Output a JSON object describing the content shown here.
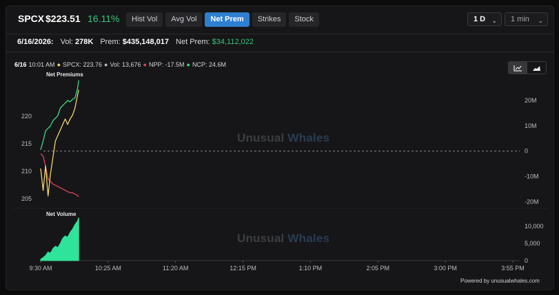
{
  "header": {
    "ticker": "SPCX",
    "price": "$223.51",
    "change_pct": "16.11%",
    "tabs": [
      {
        "label": "Hist Vol",
        "active": false
      },
      {
        "label": "Avg Vol",
        "active": false
      },
      {
        "label": "Net Prem",
        "active": true
      },
      {
        "label": "Strikes",
        "active": false
      },
      {
        "label": "Stock",
        "active": false
      }
    ],
    "range_select": "1 D",
    "interval_select": "1 min"
  },
  "stats": {
    "date": "6/16/2026:",
    "vol_label": "Vol:",
    "vol_value": "278K",
    "prem_label": "Prem:",
    "prem_value": "$435,148,017",
    "net_prem_label": "Net Prem:",
    "net_prem_value": "$34,112,022"
  },
  "legend": {
    "date": "6/16",
    "time": "10:01 AM",
    "spcx": "SPCX: 223.76",
    "vol": "Vol: 13,676",
    "npp": "NPP: -17.5M",
    "ncp": "NCP: 24.6M"
  },
  "panels": {
    "premiums_title": "Net Premiums",
    "volume_title": "Net Volume",
    "watermark_a": "Unusual",
    "watermark_b": "Whales",
    "powered_by": "Powered by unusualwhales.com"
  },
  "colors": {
    "ncp": "#3ddc84",
    "npp": "#e0455a",
    "price": "#f2d36b",
    "volume": "#2fe39a",
    "accent": "#2e7fd1"
  },
  "chart_data": {
    "type": "line",
    "x_ticks": [
      "9:30 AM",
      "10:25 AM",
      "11:20 AM",
      "12:15 PM",
      "1:10 PM",
      "2:05 PM",
      "3:00 PM",
      "3:55 PM"
    ],
    "price_axis": {
      "ticks": [
        205,
        210,
        215,
        220
      ],
      "range": [
        204,
        227
      ]
    },
    "premium_axis": {
      "ticks": [
        "20M",
        "10M",
        "0",
        "-10M",
        "-20M"
      ],
      "values": [
        20,
        10,
        0,
        -10,
        -20
      ],
      "range": [
        -21,
        29
      ]
    },
    "volume_axis": {
      "ticks": [
        "10,000",
        "5,000",
        "0"
      ],
      "values": [
        10000,
        5000,
        0
      ],
      "range": [
        0,
        13000
      ]
    },
    "minutes": [
      0,
      2,
      4,
      6,
      8,
      10,
      12,
      14,
      16,
      18,
      20,
      22,
      24,
      26,
      28,
      30,
      31
    ],
    "series": [
      {
        "name": "NCP",
        "unit": "M",
        "values": [
          0.5,
          4,
          8,
          9,
          10,
          12,
          13,
          14,
          17,
          18,
          19,
          20,
          19.5,
          20.5,
          21,
          24.6,
          28
        ]
      },
      {
        "name": "NPP",
        "unit": "M",
        "values": [
          -1,
          -2,
          -6,
          -11,
          -12,
          -13,
          -13.5,
          -14,
          -14.5,
          -15,
          -15.5,
          -16,
          -16.5,
          -16.5,
          -17,
          -17.5,
          -18
        ]
      },
      {
        "name": "SPCX",
        "values": [
          210.5,
          206.5,
          211,
          205.5,
          209.5,
          212.5,
          215.5,
          216.5,
          217.5,
          218.5,
          219.5,
          218.5,
          219.5,
          220.2,
          221.5,
          223.76,
          224.8
        ]
      }
    ],
    "volume": [
      400,
      900,
      1500,
      2500,
      2200,
      3500,
      4200,
      3800,
      5000,
      6500,
      7200,
      6800,
      8200,
      9200,
      10500,
      11500,
      12500
    ]
  }
}
